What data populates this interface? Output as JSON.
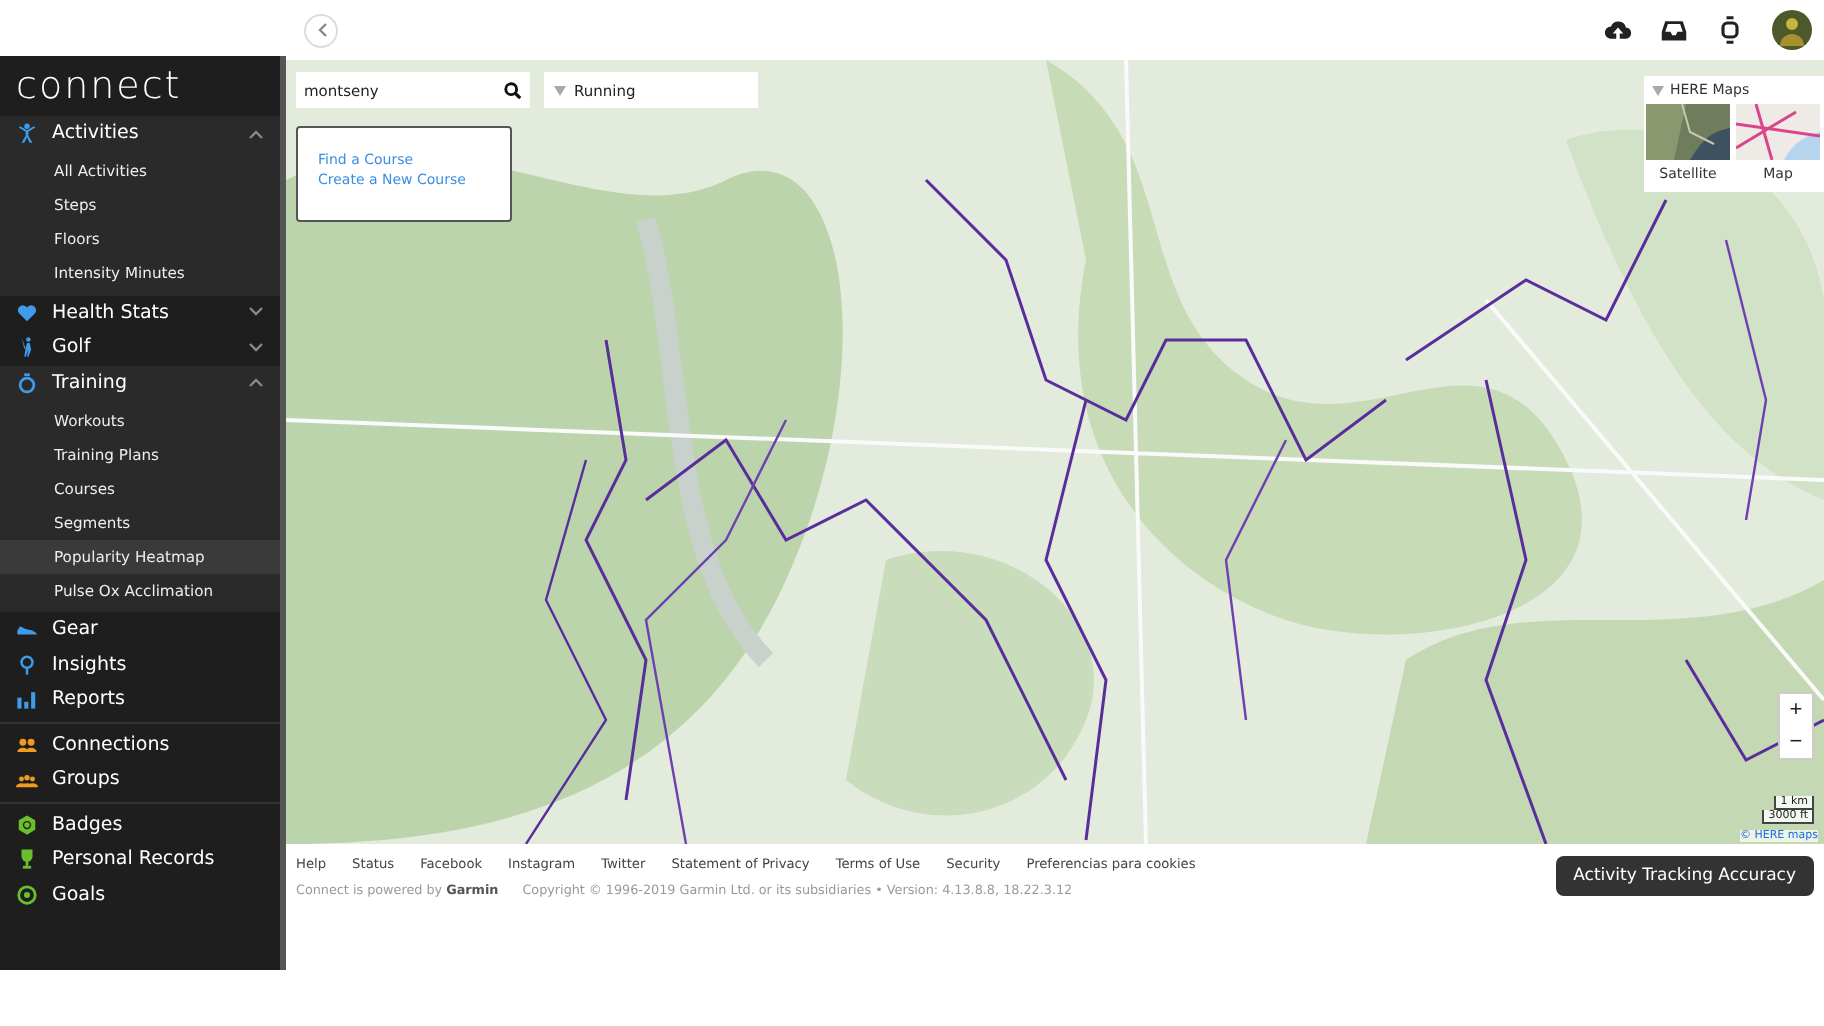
{
  "sidebar": {
    "logo": "connect",
    "sections": [
      {
        "color": "#3d9be9",
        "items": [
          {
            "label": "Activities",
            "expanded": true,
            "children": [
              {
                "label": "All Activities",
                "selected": false
              },
              {
                "label": "Steps",
                "selected": false
              },
              {
                "label": "Floors",
                "selected": false
              },
              {
                "label": "Intensity Minutes",
                "selected": false
              }
            ]
          },
          {
            "label": "Health Stats",
            "expanded": false
          },
          {
            "label": "Golf",
            "expanded": false
          },
          {
            "label": "Training",
            "expanded": true,
            "children": [
              {
                "label": "Workouts",
                "selected": false
              },
              {
                "label": "Training Plans",
                "selected": false
              },
              {
                "label": "Courses",
                "selected": false
              },
              {
                "label": "Segments",
                "selected": false
              },
              {
                "label": "Popularity Heatmap",
                "selected": true
              },
              {
                "label": "Pulse Ox Acclimation",
                "selected": false
              }
            ]
          },
          {
            "label": "Gear"
          },
          {
            "label": "Insights"
          },
          {
            "label": "Reports"
          }
        ]
      },
      {
        "color": "#f09a1e",
        "items": [
          {
            "label": "Connections"
          },
          {
            "label": "Groups"
          }
        ]
      },
      {
        "color": "#6cbf2c",
        "items": [
          {
            "label": "Badges"
          },
          {
            "label": "Personal Records"
          },
          {
            "label": "Goals"
          }
        ]
      }
    ]
  },
  "map": {
    "search": {
      "value": "montseny"
    },
    "activity_filter": {
      "value": "Running"
    },
    "course_links": [
      "Find a Course",
      "Create a New Course"
    ],
    "layers": {
      "title": "HERE Maps",
      "options": [
        {
          "label": "Satellite",
          "kind": "satellite"
        },
        {
          "label": "Map",
          "kind": "map"
        }
      ]
    },
    "zoom": [
      "+",
      "−"
    ],
    "scale": [
      "1 km",
      "3000 ft"
    ],
    "attribution": "© HERE maps"
  },
  "footer": {
    "links": [
      "Help",
      "Status",
      "Facebook",
      "Instagram",
      "Twitter",
      "Statement of Privacy",
      "Terms of Use",
      "Security",
      "Preferencias para cookies"
    ],
    "powered_by": "Connect is powered by **Garmin**",
    "copyright": "Copyright © 1996-2019 Garmin Ltd. or its subsidiaries • Version: 4.13.8.8, 18.22.3.12",
    "button": "Activity Tracking Accuracy"
  }
}
